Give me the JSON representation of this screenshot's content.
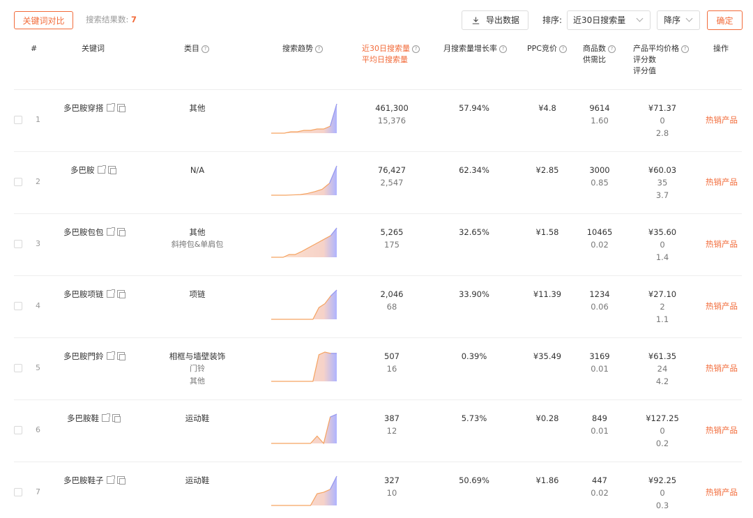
{
  "toolbar": {
    "compare_label": "关键词对比",
    "result_label": "搜索结果数:",
    "result_count": "7",
    "export_label": "导出数据",
    "sort_label": "排序:",
    "sort_value": "近30日搜索量",
    "order_value": "降序",
    "confirm_label": "确定"
  },
  "headers": {
    "index": "#",
    "keyword": "关键词",
    "category": "类目",
    "trend": "搜索趋势",
    "search30": "近30日搜索量",
    "daily": "平均日搜索量",
    "growth": "月搜索量增长率",
    "ppc": "PPC竞价",
    "products": "商品数",
    "supply": "供需比",
    "avgprice": "产品平均价格",
    "ratings": "评分数",
    "score": "评分值",
    "action": "操作"
  },
  "rows": [
    {
      "index": "1",
      "keyword": "多巴胺穿搭",
      "cat1": "其他",
      "cat2": "",
      "cat3": "",
      "search30": "461,300",
      "daily": "15,376",
      "growth": "57.94%",
      "ppc": "¥4.8",
      "products": "9614",
      "supply": "1.60",
      "price": "¥71.37",
      "ratings": "0",
      "score": "2.8",
      "action": "热销产品",
      "trend": [
        0,
        0,
        0,
        1,
        1,
        2,
        2,
        3,
        3,
        5,
        21
      ]
    },
    {
      "index": "2",
      "keyword": "多巴胺",
      "cat1": "N/A",
      "cat2": "",
      "cat3": "",
      "search30": "76,427",
      "daily": "2,547",
      "growth": "62.34%",
      "ppc": "¥2.85",
      "products": "3000",
      "supply": "0.85",
      "price": "¥60.03",
      "ratings": "35",
      "score": "3.7",
      "action": "热销产品",
      "trend": [
        0,
        0,
        0,
        0.5,
        1,
        3,
        6,
        10,
        20,
        49
      ]
    },
    {
      "index": "3",
      "keyword": "多巴胺包包",
      "cat1": "其他",
      "cat2": "斜挎包&单肩包",
      "cat3": "",
      "search30": "5,265",
      "daily": "175",
      "growth": "32.65%",
      "ppc": "¥1.58",
      "products": "10465",
      "supply": "0.02",
      "price": "¥35.60",
      "ratings": "0",
      "score": "1.4",
      "action": "热销产品",
      "trend": [
        0,
        0,
        0,
        0.5,
        0.5,
        1,
        1.6,
        2.2,
        2.8,
        3.4,
        4,
        5.4
      ]
    },
    {
      "index": "4",
      "keyword": "多巴胺项链",
      "cat1": "项链",
      "cat2": "",
      "cat3": "",
      "search30": "2,046",
      "daily": "68",
      "growth": "33.90%",
      "ppc": "¥11.39",
      "products": "1234",
      "supply": "0.06",
      "price": "¥27.10",
      "ratings": "2",
      "score": "1.1",
      "action": "热销产品",
      "trend": [
        0,
        0,
        0,
        0,
        0,
        0,
        0,
        0,
        0.6,
        0.8,
        1.2,
        1.5
      ]
    },
    {
      "index": "5",
      "keyword": "多巴胺門鈴",
      "cat1": "相框与墙壁装饰",
      "cat2": "门铃",
      "cat3": "其他",
      "search30": "507",
      "daily": "16",
      "growth": "0.39%",
      "ppc": "¥35.49",
      "products": "3169",
      "supply": "0.01",
      "price": "¥61.35",
      "ratings": "24",
      "score": "4.2",
      "action": "热销产品",
      "trend": [
        0,
        0,
        0,
        0,
        0,
        0,
        0,
        0,
        1,
        1.1,
        1.05,
        1.05
      ]
    },
    {
      "index": "6",
      "keyword": "多巴胺鞋",
      "cat1": "运动鞋",
      "cat2": "",
      "cat3": "",
      "search30": "387",
      "daily": "12",
      "growth": "5.73%",
      "ppc": "¥0.28",
      "products": "849",
      "supply": "0.01",
      "price": "¥127.25",
      "ratings": "0",
      "score": "0.2",
      "action": "热销产品",
      "trend": [
        0,
        0,
        0,
        0,
        0,
        0,
        0,
        0.25,
        0,
        0.9,
        1
      ]
    },
    {
      "index": "7",
      "keyword": "多巴胺鞋子",
      "cat1": "运动鞋",
      "cat2": "",
      "cat3": "",
      "search30": "327",
      "daily": "10",
      "growth": "50.69%",
      "ppc": "¥1.86",
      "products": "447",
      "supply": "0.02",
      "price": "¥92.25",
      "ratings": "0",
      "score": "0.3",
      "action": "热销产品",
      "trend": [
        0,
        0,
        0,
        0,
        0,
        0,
        0,
        0.4,
        0.45,
        0.55,
        1
      ]
    }
  ]
}
